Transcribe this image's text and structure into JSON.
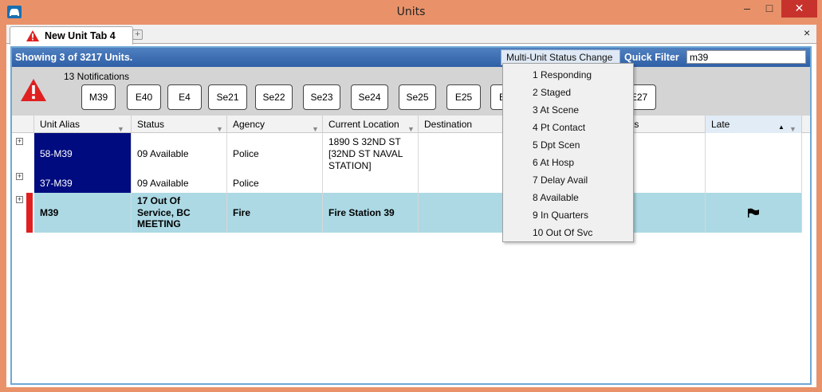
{
  "window": {
    "title": "Units",
    "min_glyph": "‒",
    "max_glyph": "□",
    "close_glyph": "✕",
    "icon": "car-icon"
  },
  "tabs": [
    {
      "label": "New Unit Tab 4",
      "icon": "warning-icon"
    }
  ],
  "tab_add_glyph": "+",
  "panel_close_glyph": "×",
  "header": {
    "showing": "Showing 3 of 3217 Units.",
    "multi_unit_button": "Multi-Unit Status Change",
    "quick_filter_label": "Quick Filter",
    "quick_filter_value": "m39"
  },
  "notifications": {
    "label": "13 Notifications",
    "units": [
      "M39",
      "E40",
      "E4",
      "Se21",
      "Se22",
      "Se23",
      "Se24",
      "Se25",
      "E25",
      "E",
      "E27"
    ]
  },
  "columns": [
    "Unit Alias",
    "Status",
    "Agency",
    "Current Location",
    "Destination",
    "ts",
    "Late"
  ],
  "rows": [
    {
      "alias": "58-M39",
      "status": "09  Available",
      "agency": "Police",
      "location": "1890 S 32ND ST [32ND ST NAVAL STATION]",
      "late_flag": false
    },
    {
      "alias": "37-M39",
      "status": "09  Available",
      "agency": "Police",
      "location": "",
      "late_flag": false
    },
    {
      "alias": "M39",
      "status": "17  Out Of Service, BC MEETING",
      "agency": "Fire",
      "location": "Fire Station 39",
      "late_flag": true
    }
  ],
  "status_menu": [
    "1 Responding",
    "2 Staged",
    "3 At Scene",
    "4 Pt Contact",
    "5 Dpt Scen",
    "6 At Hosp",
    "7 Delay Avail",
    "8 Available",
    "9 In Quarters",
    "10 Out Of Svc"
  ],
  "colors": {
    "accent": "#e9926a",
    "header_blue": "#2f5fa6",
    "navy": "#000b7f",
    "selected_row": "#acd9e4",
    "alert_red": "#e02020"
  }
}
